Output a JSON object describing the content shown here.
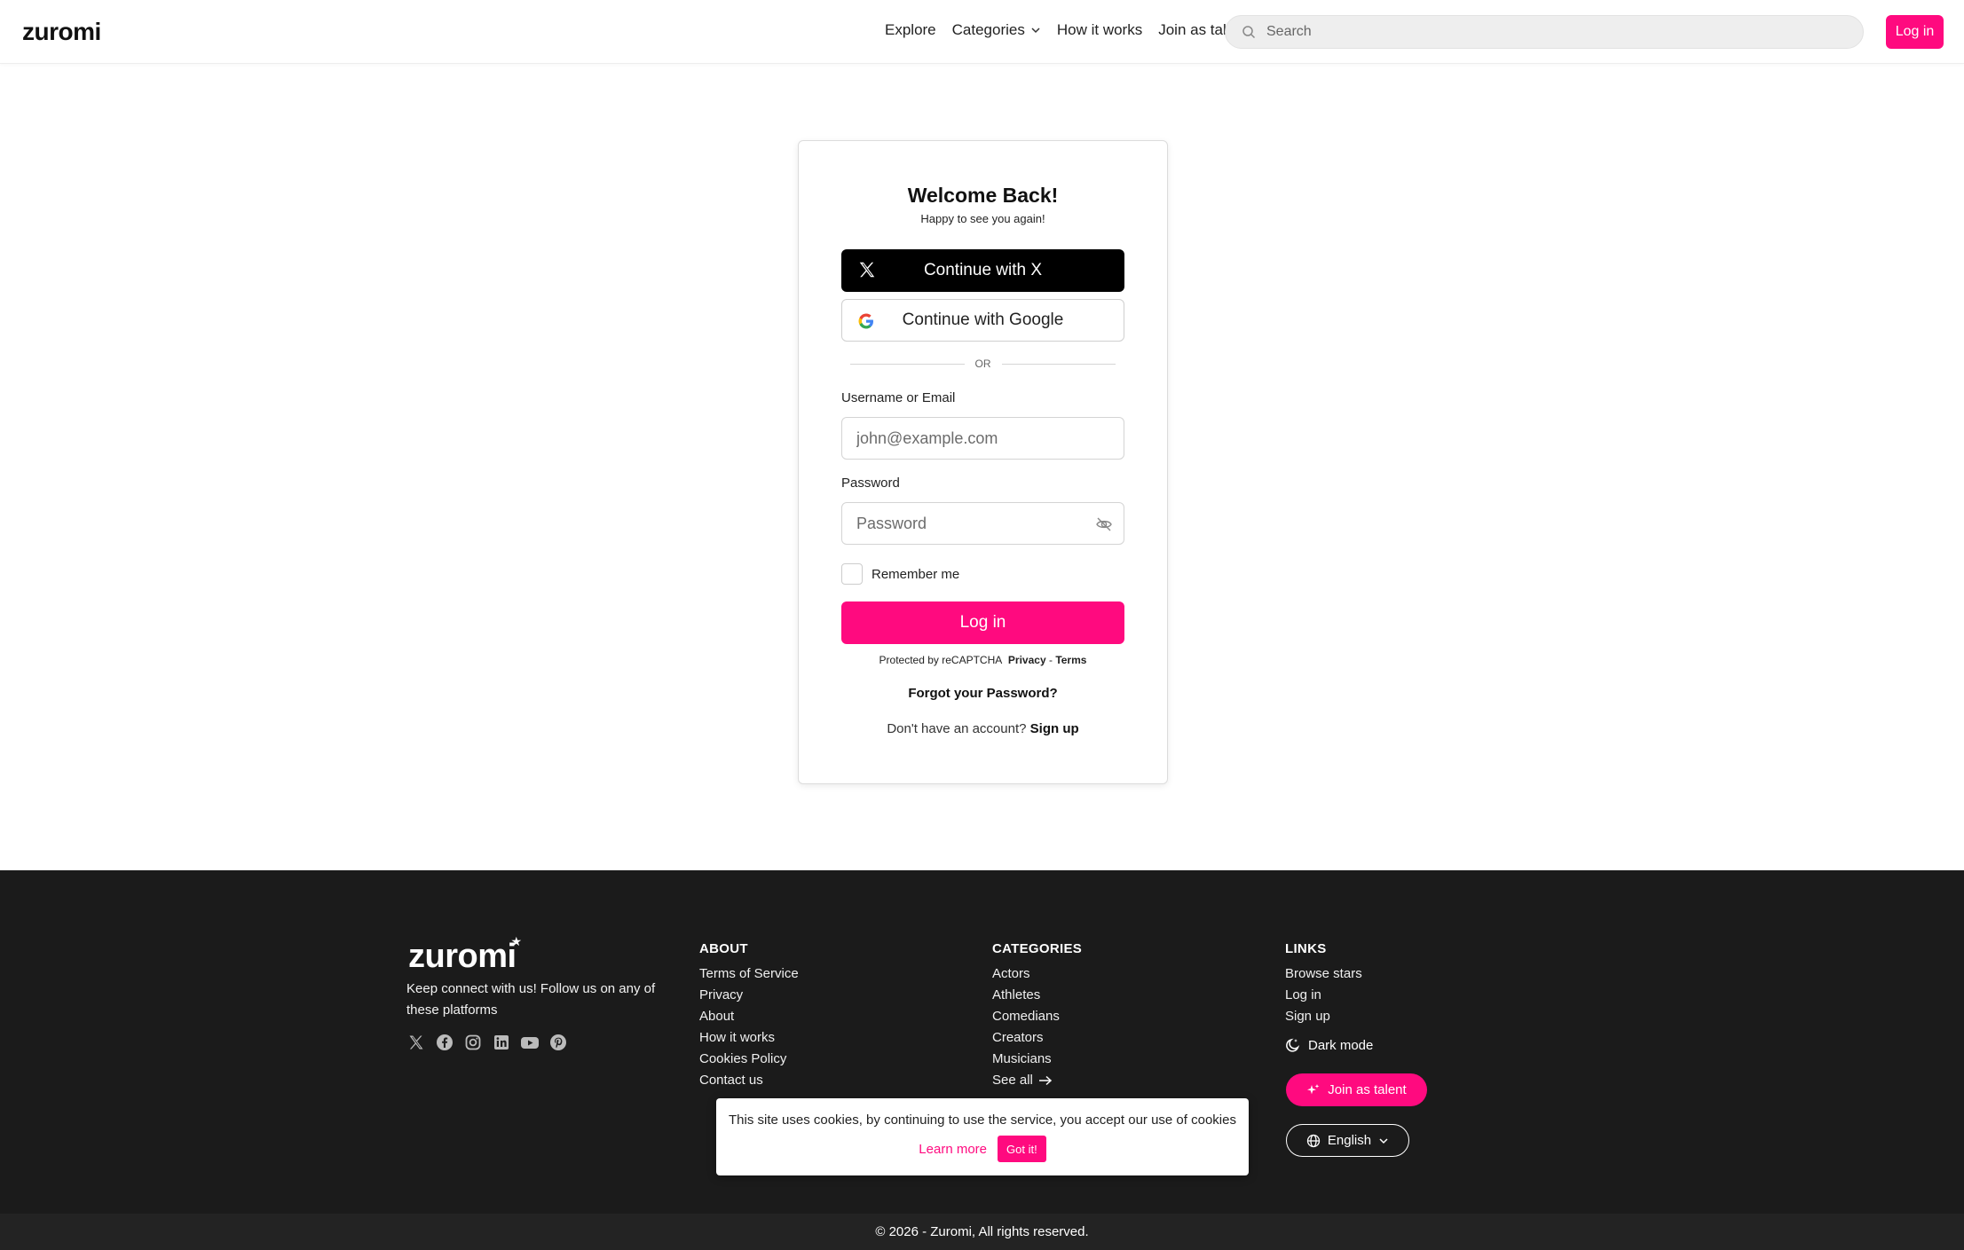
{
  "header": {
    "logo": "zuromi",
    "nav": {
      "explore": "Explore",
      "categories": "Categories",
      "how_it_works": "How it works",
      "join_as_talent": "Join as talent"
    },
    "search_placeholder": "Search",
    "login_label": "Log in"
  },
  "login_card": {
    "title": "Welcome Back!",
    "subtitle": "Happy to see you again!",
    "continue_x": "Continue with X",
    "continue_google": "Continue with Google",
    "or_divider": "OR",
    "username_label": "Username or Email",
    "username_placeholder": "john@example.com",
    "password_label": "Password",
    "password_placeholder": "Password",
    "remember_me": "Remember me",
    "login_button": "Log in",
    "recaptcha_prefix": "Protected by reCAPTCHA",
    "recaptcha_privacy": "Privacy",
    "recaptcha_sep": "-",
    "recaptcha_terms": "Terms",
    "forgot_password": "Forgot your Password?",
    "no_account": "Don't have an account?",
    "sign_up": "Sign up"
  },
  "footer": {
    "logo": "zuromi",
    "tagline": "Keep connect with us! Follow us on any of these platforms",
    "social_icons": [
      "x-icon",
      "facebook-icon",
      "instagram-icon",
      "linkedin-icon",
      "youtube-icon",
      "pinterest-icon"
    ],
    "about": {
      "heading": "ABOUT",
      "links": [
        "Terms of Service",
        "Privacy",
        "About",
        "How it works",
        "Cookies Policy",
        "Contact us"
      ]
    },
    "categories": {
      "heading": "CATEGORIES",
      "links": [
        "Actors",
        "Athletes",
        "Comedians",
        "Creators",
        "Musicians"
      ],
      "see_all": "See all"
    },
    "links": {
      "heading": "LINKS",
      "links": [
        "Browse stars",
        "Log in",
        "Sign up"
      ]
    },
    "dark_mode": "Dark mode",
    "join_as_talent": "Join as talent",
    "language": "English",
    "copyright": "© 2026 - Zuromi, All rights reserved."
  },
  "cookie_banner": {
    "text": "This site uses cookies, by continuing to use the service, you accept our use of cookies",
    "learn_more": "Learn more",
    "got_it": "Got it!"
  },
  "colors": {
    "accent": "#ff0a7f",
    "footer_bg": "#1b1b1b",
    "dark_button": "#000000"
  }
}
